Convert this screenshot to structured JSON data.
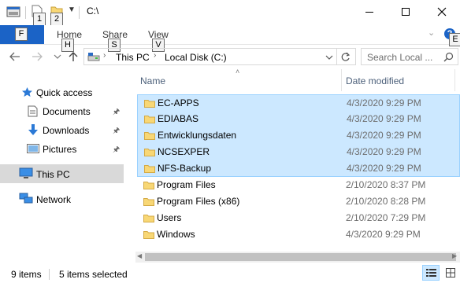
{
  "title_bar": {
    "path_title": "C:\\",
    "qat_keytips": [
      "1",
      "2"
    ]
  },
  "ribbon": {
    "file_keytip": "F",
    "tabs": [
      {
        "label": "Home",
        "keytip": "H"
      },
      {
        "label": "Share",
        "keytip": "S"
      },
      {
        "label": "View",
        "keytip": "V"
      }
    ],
    "help_keytip": "E"
  },
  "address_bar": {
    "crumbs": [
      "This PC",
      "Local Disk (C:)"
    ],
    "search_placeholder": "Search Local ..."
  },
  "nav_pane": {
    "items": [
      {
        "label": "Quick access",
        "icon": "star-icon"
      },
      {
        "label": "Documents",
        "icon": "documents-icon",
        "pinned": true
      },
      {
        "label": "Downloads",
        "icon": "download-icon",
        "pinned": true
      },
      {
        "label": "Pictures",
        "icon": "pictures-icon",
        "pinned": true
      },
      {
        "label": "This PC",
        "icon": "computer-icon",
        "selected": true
      },
      {
        "label": "Network",
        "icon": "network-icon"
      }
    ]
  },
  "file_list": {
    "columns": {
      "name": "Name",
      "date": "Date modified"
    },
    "rows": [
      {
        "name": "EC-APPS",
        "date": "4/3/2020 9:29 PM",
        "selected": true
      },
      {
        "name": "EDIABAS",
        "date": "4/3/2020 9:29 PM",
        "selected": true
      },
      {
        "name": "Entwicklungsdaten",
        "date": "4/3/2020 9:29 PM",
        "selected": true
      },
      {
        "name": "NCSEXPER",
        "date": "4/3/2020 9:29 PM",
        "selected": true
      },
      {
        "name": "NFS-Backup",
        "date": "4/3/2020 9:29 PM",
        "selected": true
      },
      {
        "name": "Program Files",
        "date": "2/10/2020 8:37 PM",
        "selected": false
      },
      {
        "name": "Program Files (x86)",
        "date": "2/10/2020 8:28 PM",
        "selected": false
      },
      {
        "name": "Users",
        "date": "2/10/2020 7:29 PM",
        "selected": false
      },
      {
        "name": "Windows",
        "date": "4/3/2020 9:29 PM",
        "selected": false
      }
    ]
  },
  "status_bar": {
    "item_count": "9 items",
    "selected_count": "5 items selected"
  },
  "colors": {
    "accent": "#1b63c6",
    "selection": "#cce8ff",
    "selection_border": "#99d1ff",
    "folder": "#f8d775"
  }
}
